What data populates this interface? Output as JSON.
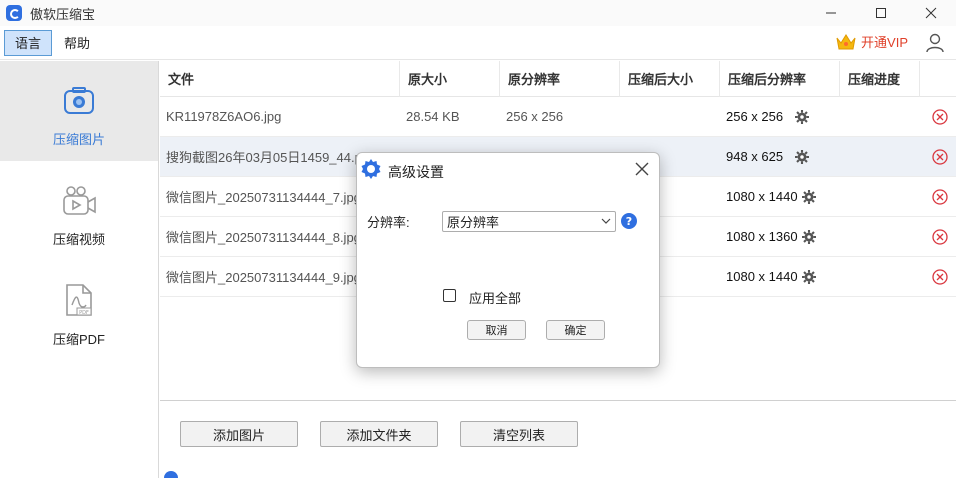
{
  "titlebar": {
    "app_title": "傲软压缩宝",
    "minimize": "—",
    "maximize": "□",
    "close": "✕"
  },
  "menu": {
    "language": "语言",
    "help": "帮助",
    "vip_label": "开通VIP"
  },
  "sidebar": {
    "items": [
      {
        "label": "压缩图片",
        "icon": "image-compress-icon"
      },
      {
        "label": "压缩视频",
        "icon": "video-camera-icon"
      },
      {
        "label": "压缩PDF",
        "icon": "pdf-file-icon"
      }
    ]
  },
  "table": {
    "headers": [
      "文件",
      "原大小",
      "原分辨率",
      "压缩后大小",
      "压缩后分辨率",
      "压缩进度"
    ],
    "rows": [
      {
        "file": "KR11978Z6AO6.jpg",
        "size": "28.54 KB",
        "res": "256 x 256",
        "out_size": "",
        "out_res": "256 x 256"
      },
      {
        "file": "搜狗截图26年03月05日1459_44.png",
        "size": "",
        "res": "",
        "out_size": "",
        "out_res": "948 x 625"
      },
      {
        "file": "微信图片_20250731134444_7.jpg",
        "size": "",
        "res": "",
        "out_size": "",
        "out_res": "1080 x 1440"
      },
      {
        "file": "微信图片_20250731134444_8.jpg",
        "size": "",
        "res": "",
        "out_size": "",
        "out_res": "1080 x 1360"
      },
      {
        "file": "微信图片_20250731134444_9.jpg",
        "size": "",
        "res": "",
        "out_size": "",
        "out_res": "1080 x 1440"
      }
    ]
  },
  "toolbar": {
    "add_images": "添加图片",
    "add_folder": "添加文件夹",
    "clear_list": "清空列表"
  },
  "dialog": {
    "title": "高级设置",
    "resolution_label": "分辨率:",
    "resolution_value": "原分辨率",
    "apply_all": "应用全部",
    "cancel": "取消",
    "ok": "确定"
  },
  "colors": {
    "accent": "#3a7bd5",
    "vip": "#e0402a",
    "delete": "#d9363e"
  }
}
